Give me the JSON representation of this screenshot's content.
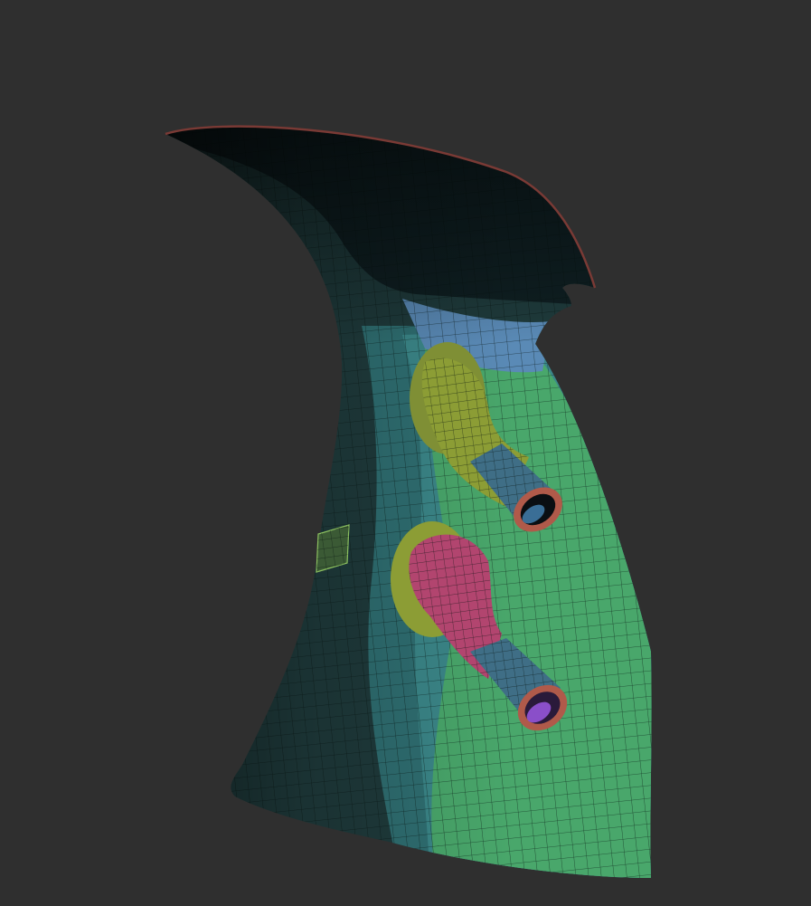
{
  "viewport": {
    "background_color": "#2f2f2f",
    "subject": "mesh",
    "view_mode": "polyframe"
  },
  "mesh": {
    "polygroups": [
      {
        "name": "top-flare",
        "color": "#0f1f22"
      },
      {
        "name": "dark-left",
        "color": "#1f3b3c"
      },
      {
        "name": "teal-band",
        "color": "#2f6f72"
      },
      {
        "name": "blue-band",
        "color": "#5a8ab6"
      },
      {
        "name": "green-face",
        "color": "#49a76b"
      },
      {
        "name": "olive-socket",
        "color": "#8c9d35"
      },
      {
        "name": "magenta-socket",
        "color": "#b2456f"
      },
      {
        "name": "tube-blue",
        "color": "#3f6e86"
      },
      {
        "name": "tube-inner-purple",
        "color": "#8a4fc9"
      },
      {
        "name": "rim-red",
        "color": "#b05a4a"
      }
    ],
    "wire_color": "#0b1a18",
    "tubes": [
      {
        "name": "upper-tube",
        "socket_group": "olive-socket"
      },
      {
        "name": "lower-tube",
        "socket_group": "magenta-socket"
      }
    ]
  }
}
